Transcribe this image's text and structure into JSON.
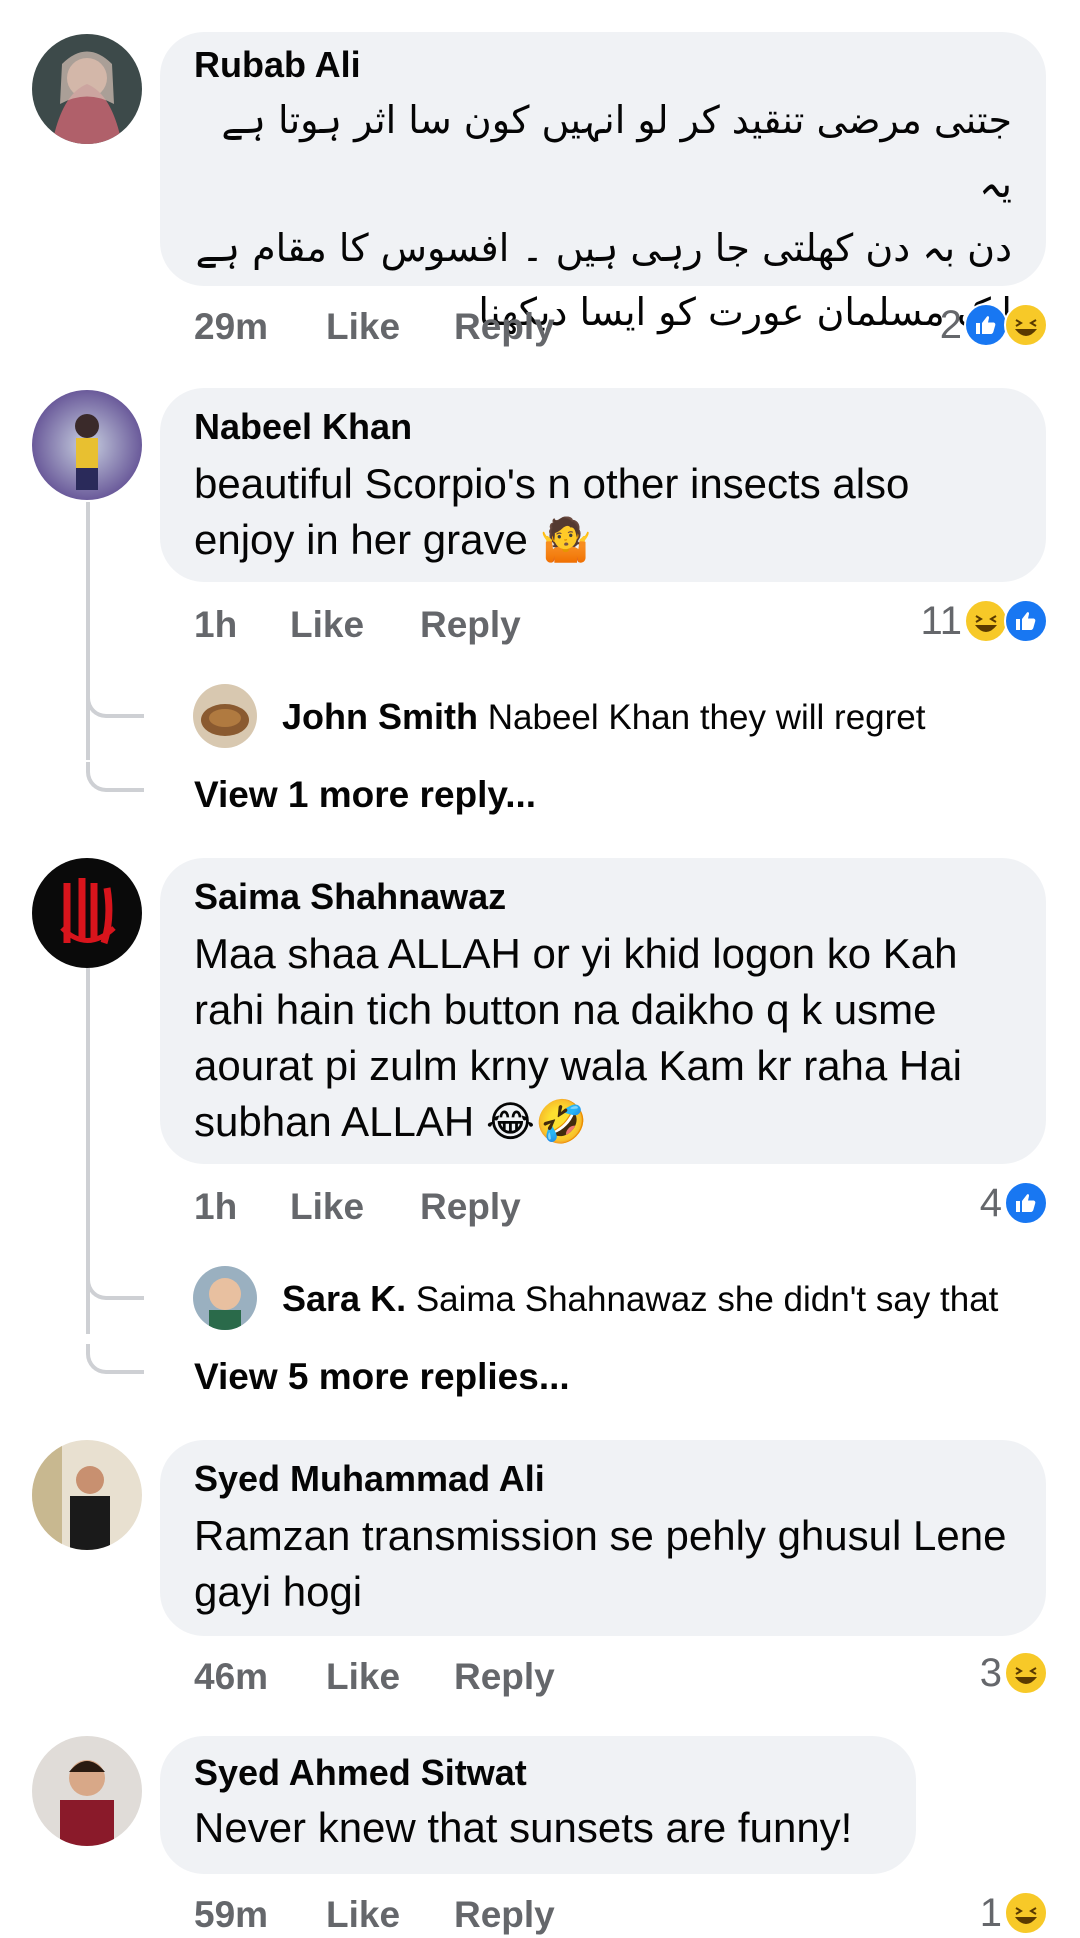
{
  "comments": [
    {
      "name": "Rubab Ali",
      "lines": [
        "جتنی مرضی تنقید کر لو انہیں کون سا اثر ہوتا ہے یہ",
        "دن بہ دن کھلتی جا رہی ہیں ۔ افسوس کا مقام ہے",
        "ایک مسلمان عورت کو ایسا دیکھنا"
      ],
      "time": "29m",
      "like": "Like",
      "reply": "Reply",
      "count": "2",
      "reactions": [
        "like-icon",
        "haha-icon"
      ]
    },
    {
      "name": "Nabeel Khan",
      "text": "beautiful Scorpio's n other insects also enjoy in her grave 🤷",
      "time": "1h",
      "like": "Like",
      "reply": "Reply",
      "count": "11",
      "reactions": [
        "haha-icon",
        "like-icon"
      ],
      "reply_preview": {
        "name": "John Smith",
        "text": "Nabeel Khan they will regret"
      },
      "more": "View 1 more reply..."
    },
    {
      "name": "Saima Shahnawaz",
      "text": "Maa shaa ALLAH or yi khid logon ko Kah rahi hain tich button na daikho q k usme aourat pi zulm krny wala Kam kr raha Hai subhan ALLAH 😂🤣",
      "time": "1h",
      "like": "Like",
      "reply": "Reply",
      "count": "4",
      "reactions": [
        "like-icon"
      ],
      "reply_preview": {
        "name": "Sara K.",
        "text": "Saima Shahnawaz she didn't say that"
      },
      "more": "View 5 more replies..."
    },
    {
      "name": "Syed Muhammad Ali",
      "text": "Ramzan transmission se pehly ghusul Lene gayi hogi",
      "time": "46m",
      "like": "Like",
      "reply": "Reply",
      "count": "3",
      "reactions": [
        "haha-icon"
      ]
    },
    {
      "name": "Syed Ahmed Sitwat",
      "text": "Never knew that sunsets are funny!",
      "time": "59m",
      "like": "Like",
      "reply": "Reply",
      "count": "1",
      "reactions": [
        "haha-icon"
      ]
    }
  ],
  "colors": {
    "bubble": "#f0f2f5",
    "like": "#1877f2",
    "haha": "#f7c928",
    "meta": "#65676b"
  }
}
